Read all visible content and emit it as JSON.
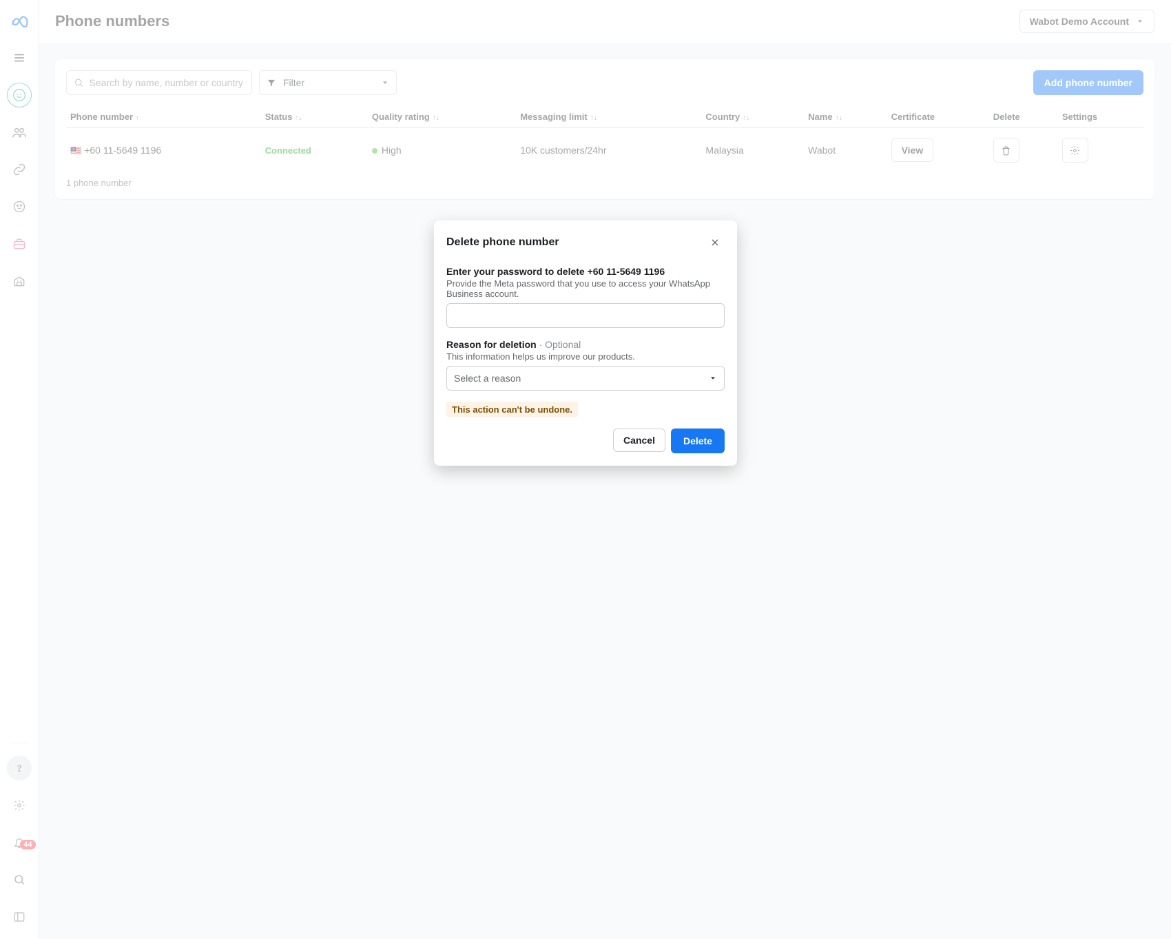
{
  "header": {
    "title": "Phone numbers",
    "account": "Wabot Demo Account"
  },
  "sidebar": {
    "notifications_badge": "44"
  },
  "toolbar": {
    "search_placeholder": "Search by name, number or country",
    "filter_label": "Filter",
    "add_button": "Add phone number"
  },
  "table": {
    "columns": {
      "phone": "Phone number",
      "status": "Status",
      "quality": "Quality rating",
      "messaging": "Messaging limit",
      "country": "Country",
      "name": "Name",
      "certificate": "Certificate",
      "delete": "Delete",
      "settings": "Settings"
    },
    "rows": [
      {
        "flag": "🇲🇾",
        "phone": "+60 11-5649 1196",
        "status": "Connected",
        "quality": "High",
        "messaging": "10K customers/24hr",
        "country": "Malaysia",
        "name": "Wabot",
        "certificate_btn": "View"
      }
    ],
    "footer": "1 phone number"
  },
  "modal": {
    "title": "Delete phone number",
    "password_label": "Enter your password to delete +60 11-5649 1196",
    "password_help": "Provide the Meta password that you use to access your WhatsApp Business account.",
    "reason_label": "Reason for deletion",
    "optional_tag": " ·  Optional",
    "reason_help": "This information helps us improve our products.",
    "reason_placeholder": "Select a reason",
    "warning": "This action can't be undone.",
    "cancel": "Cancel",
    "delete": "Delete"
  }
}
